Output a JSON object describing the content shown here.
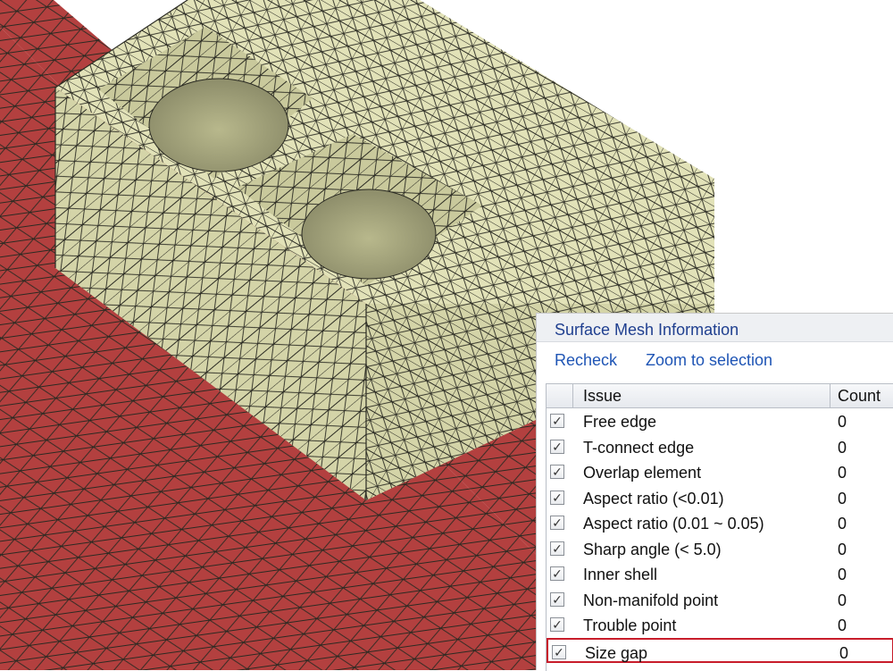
{
  "colors": {
    "ground_fill": "#b3403f",
    "part_top": "#e2e2b8",
    "part_side": "#d4d4a8",
    "part_inner": "#c9c99c",
    "mesh_line": "#2a2a22",
    "highlight_border": "#c81c2a",
    "link_blue": "#1f55b5"
  },
  "panel": {
    "title": "Surface Mesh Information",
    "actions": {
      "recheck": "Recheck",
      "zoom": "Zoom to selection"
    },
    "columns": {
      "issue": "Issue",
      "count": "Count"
    },
    "rows": [
      {
        "issue": "Free edge",
        "count": "0",
        "checked": true
      },
      {
        "issue": "T-connect edge",
        "count": "0",
        "checked": true
      },
      {
        "issue": "Overlap element",
        "count": "0",
        "checked": true
      },
      {
        "issue": "Aspect ratio (<0.01)",
        "count": "0",
        "checked": true
      },
      {
        "issue": "Aspect ratio (0.01 ~ 0.05)",
        "count": "0",
        "checked": true
      },
      {
        "issue": "Sharp angle (< 5.0)",
        "count": "0",
        "checked": true
      },
      {
        "issue": "Inner shell",
        "count": "0",
        "checked": true
      },
      {
        "issue": "Non-manifold point",
        "count": "0",
        "checked": true
      },
      {
        "issue": "Trouble point",
        "count": "0",
        "checked": true
      },
      {
        "issue": "Size gap",
        "count": "0",
        "checked": true,
        "highlighted": true
      }
    ]
  }
}
